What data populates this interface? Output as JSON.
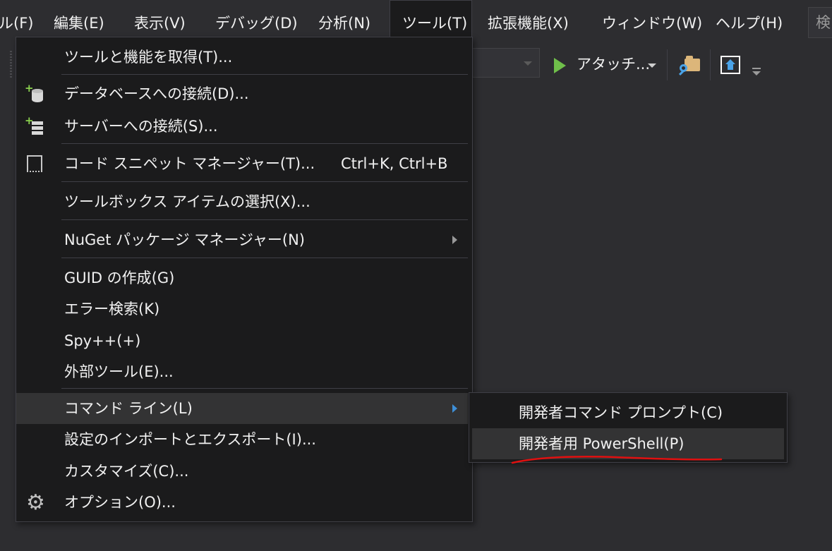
{
  "menubar": {
    "items": [
      "ル(F)",
      "編集(E)",
      "表示(V)",
      "デバッグ(D)",
      "分析(N)",
      "ツール(T)",
      "拡張機能(X)",
      "ウィンドウ(W)",
      "ヘルプ(H)"
    ],
    "active": "ツール(T)",
    "search_text": "検"
  },
  "toolbar": {
    "attach_label": "アタッチ..."
  },
  "tools_menu": {
    "items": [
      {
        "label": "ツールと機能を取得(T)..."
      },
      {
        "label": "データベースへの接続(D)...",
        "icon": "database-connect-icon"
      },
      {
        "label": "サーバーへの接続(S)...",
        "icon": "server-connect-icon"
      },
      {
        "label": "コード スニペット マネージャー(T)...",
        "icon": "snippet-icon",
        "shortcut": "Ctrl+K, Ctrl+B"
      },
      {
        "label": "ツールボックス アイテムの選択(X)..."
      },
      {
        "label": "NuGet パッケージ マネージャー(N)",
        "submenu": true
      },
      {
        "label": "GUID の作成(G)"
      },
      {
        "label": "エラー検索(K)"
      },
      {
        "label": "Spy++(+)"
      },
      {
        "label": "外部ツール(E)..."
      },
      {
        "label": "コマンド ライン(L)",
        "submenu": true,
        "highlighted": true
      },
      {
        "label": "設定のインポートとエクスポート(I)..."
      },
      {
        "label": "カスタマイズ(C)..."
      },
      {
        "label": "オプション(O)...",
        "icon": "gear-icon"
      }
    ]
  },
  "command_line_submenu": {
    "items": [
      {
        "label": "開発者コマンド プロンプト(C)"
      },
      {
        "label": "開発者用 PowerShell(P)",
        "highlighted": true
      }
    ]
  },
  "colors": {
    "background": "#2d2d30",
    "menu_background": "#1b1b1c",
    "highlight": "#333334",
    "annotation": "#e01010",
    "play_green": "#6fbf4a"
  }
}
